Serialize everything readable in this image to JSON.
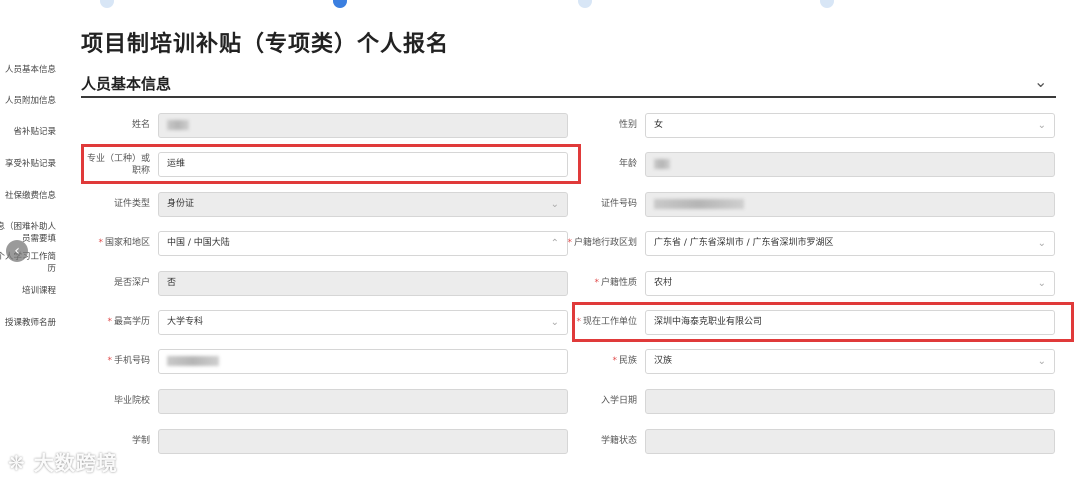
{
  "page_title": "项目制培训补贴（专项类）个人报名",
  "section_title": "人员基本信息",
  "icons": {
    "section_toggle": "chevron-down-icon",
    "sidebar_collapse": "chevron-left-icon",
    "select_arrow": "chevron-down-icon"
  },
  "sidebar": {
    "items": [
      {
        "label": "人员基本信息"
      },
      {
        "label": "人员附加信息"
      },
      {
        "label": "省补贴记录"
      },
      {
        "label": "享受补贴记录"
      },
      {
        "label": "社保缴费信息"
      },
      {
        "label": "银行信息（困难补助人员需要填"
      },
      {
        "label": "个人学习工作简历"
      },
      {
        "label": "培训课程"
      },
      {
        "label": "授课教师名册"
      }
    ]
  },
  "form": {
    "name": {
      "label": "姓名",
      "value": ""
    },
    "gender": {
      "label": "性别",
      "value": "女"
    },
    "major": {
      "label": "专业（工种）或职称",
      "value": "运维"
    },
    "age": {
      "label": "年龄",
      "value": ""
    },
    "id_type": {
      "label": "证件类型",
      "value": "身份证"
    },
    "id_number": {
      "label": "证件号码",
      "value": ""
    },
    "country": {
      "label": "国家和地区",
      "value": "中国 / 中国大陆"
    },
    "hukou_region": {
      "label": "户籍地行政区划",
      "value": "广东省 / 广东省深圳市 / 广东省深圳市罗湖区"
    },
    "poverty": {
      "label": "是否深户",
      "value": "否"
    },
    "hukou_type": {
      "label": "户籍性质",
      "value": "农村"
    },
    "education": {
      "label": "最高学历",
      "value": "大学专科"
    },
    "employer": {
      "label": "现在工作单位",
      "value": "深圳中海泰克职业有限公司"
    },
    "phone": {
      "label": "手机号码",
      "value": ""
    },
    "ethnicity": {
      "label": "民族",
      "value": "汉族"
    },
    "school": {
      "label": "毕业院校",
      "value": ""
    },
    "enroll_date": {
      "label": "入学日期",
      "value": ""
    },
    "study_length": {
      "label": "学制",
      "value": ""
    },
    "status": {
      "label": "学籍状态",
      "value": ""
    }
  },
  "highlight_color": "#e03a3a",
  "watermark": "大数跨境"
}
